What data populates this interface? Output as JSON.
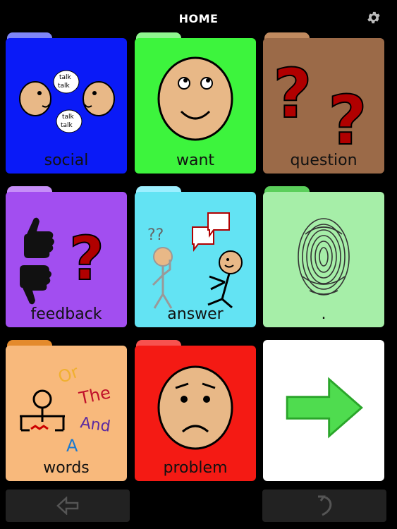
{
  "header": {
    "title": "HOME",
    "settings_icon": "gear-icon"
  },
  "tiles": [
    {
      "label": "social",
      "color": "#0a1af7",
      "tab": "#7f86f7"
    },
    {
      "label": "want",
      "color": "#3df43d",
      "tab": "#8ff58f"
    },
    {
      "label": "question",
      "color": "#9b6a48",
      "tab": "#c08a5f"
    },
    {
      "label": "feedback",
      "color": "#a24ef0",
      "tab": "#c68ef8"
    },
    {
      "label": "answer",
      "color": "#63e3f3",
      "tab": "#9defff"
    },
    {
      "label": ".",
      "color": "#a6eea8",
      "tab": "#5bcf5b"
    },
    {
      "label": "words",
      "color": "#f8b97c",
      "tab": "#e48a2c"
    },
    {
      "label": "problem",
      "color": "#f41a14",
      "tab": "#f7524f"
    },
    {
      "label": "",
      "color": "#ffffff",
      "tab": "#ffffff"
    }
  ],
  "pictures": {
    "social_bubbles": [
      "talk",
      "talk",
      "talk",
      "talk"
    ],
    "words_text": [
      "Or",
      "The",
      "And",
      "A"
    ]
  },
  "nav": {
    "back_icon": "left-arrow-icon",
    "undo_icon": "undo-icon"
  }
}
